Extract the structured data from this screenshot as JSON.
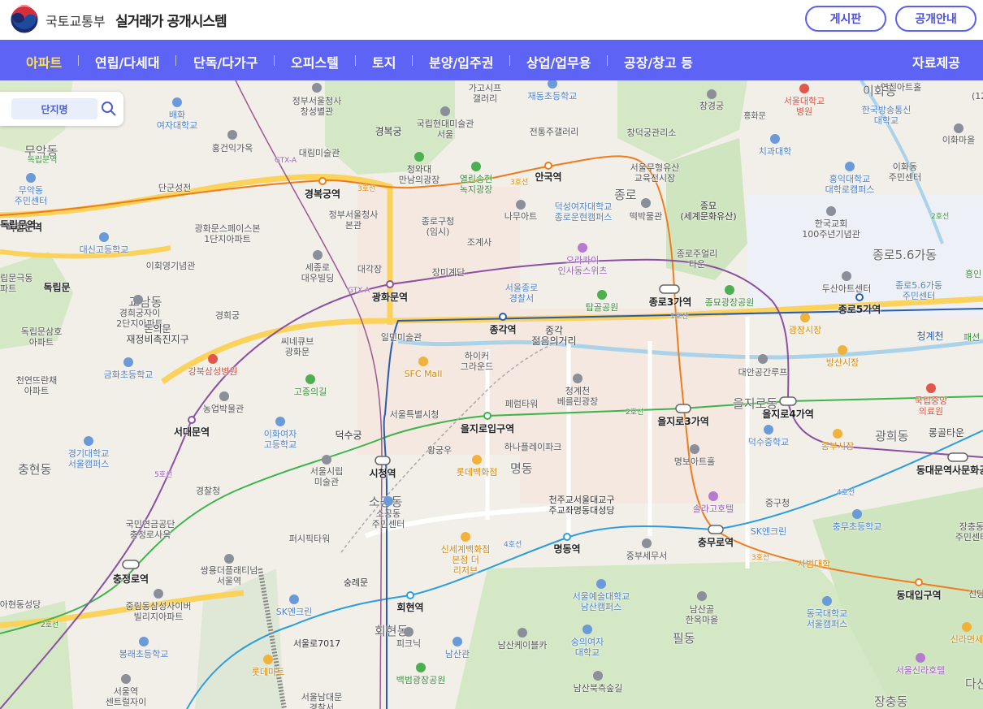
{
  "header": {
    "ministry": "국토교통부",
    "system_title": "실거래가 공개시스템",
    "board_button": "게시판",
    "info_button": "공개안내"
  },
  "nav": {
    "items": [
      "아파트",
      "연립/다세대",
      "단독/다가구",
      "오피스텔",
      "토지",
      "분양/입주권",
      "상업/업무용",
      "공장/창고 등"
    ],
    "active": "아파트",
    "data_button": "자료제공"
  },
  "search": {
    "tab_label": "단지명",
    "icon": "search-icon"
  },
  "colors": {
    "nav_bg": "#5d63f5",
    "active_nav": "#ffe24a",
    "line1": "#2a5caa",
    "line2": "#3cb44a",
    "line3": "#ef7c1c",
    "line4": "#2c9ede",
    "line5": "#8b50a4",
    "road": "#fbd25a"
  },
  "map": {
    "stations": [
      {
        "name": "경복궁역"
      },
      {
        "name": "안국역"
      },
      {
        "name": "광화문역"
      },
      {
        "name": "종각역"
      },
      {
        "name": "종로3가역"
      },
      {
        "name": "종로5가역"
      },
      {
        "name": "을지로입구역"
      },
      {
        "name": "을지로3가역"
      },
      {
        "name": "을지로4가역"
      },
      {
        "name": "시청역"
      },
      {
        "name": "서대문역"
      },
      {
        "name": "충정로역"
      },
      {
        "name": "명동역"
      },
      {
        "name": "충무로역"
      },
      {
        "name": "회현역"
      },
      {
        "name": "동대문역사문화공"
      },
      {
        "name": "동대입구역"
      },
      {
        "name": "독립문역"
      },
      {
        "name": "독립문"
      }
    ],
    "areas": [
      {
        "name": "무악동"
      },
      {
        "name": "종로"
      },
      {
        "name": "종로5.6가동"
      },
      {
        "name": "을지로동"
      },
      {
        "name": "명동"
      },
      {
        "name": "소공동"
      },
      {
        "name": "광희동"
      },
      {
        "name": "필동"
      },
      {
        "name": "회현동"
      },
      {
        "name": "충현동"
      },
      {
        "name": "이화동"
      },
      {
        "name": "장충동"
      },
      {
        "name": "교남동"
      },
      {
        "name": "다산"
      }
    ],
    "pois": [
      {
        "name": "정부서울청사\n창성별관"
      },
      {
        "name": "가고시프\n갤러리"
      },
      {
        "name": "재동초등학교"
      },
      {
        "name": "창경궁"
      },
      {
        "name": "서울대학교\n병원"
      },
      {
        "name": "연진아트홀"
      },
      {
        "name": "한국방송통신\n대학교"
      },
      {
        "name": "이화마을"
      },
      {
        "name": "배화\n여자대학교"
      },
      {
        "name": "경복궁"
      },
      {
        "name": "국립현대미술관\n서울"
      },
      {
        "name": "전통주갤러리"
      },
      {
        "name": "창덕궁관리소"
      },
      {
        "name": "홍화문"
      },
      {
        "name": "치과대학"
      },
      {
        "name": "이화동\n주민센터"
      },
      {
        "name": "홍건익가옥"
      },
      {
        "name": "대림미술관"
      },
      {
        "name": "청와대\n만남의광장"
      },
      {
        "name": "열린송현\n녹지광장"
      },
      {
        "name": "서울무형유산\n교육전시장"
      },
      {
        "name": "홍익대학교\n대학로캠퍼스"
      },
      {
        "name": "독립문역"
      },
      {
        "name": "무악동\n주민센터"
      },
      {
        "name": "단군성전"
      },
      {
        "name": "정부서울청사\n본관"
      },
      {
        "name": "덕성여자대학교\n종로운현캠퍼스"
      },
      {
        "name": "나무아트"
      },
      {
        "name": "떡박물관"
      },
      {
        "name": "종묘\n(세계문화유산)"
      },
      {
        "name": "한국교회\n100주년기념관"
      },
      {
        "name": "종로구청\n(임시)"
      },
      {
        "name": "조계사"
      },
      {
        "name": "광화문스페이스본\n1단지아파트"
      },
      {
        "name": "대신고등학교"
      },
      {
        "name": "이회영기념관"
      },
      {
        "name": "세종로\n대우빌딩"
      },
      {
        "name": "대각장"
      },
      {
        "name": "장미계단"
      },
      {
        "name": "오라카이\n인사동스위츠"
      },
      {
        "name": "종로주얼리\n타운"
      },
      {
        "name": "두산아트센터"
      },
      {
        "name": "종로5.6가동\n주민센터"
      },
      {
        "name": "경희궁자이\n2단지아파트"
      },
      {
        "name": "돈의문\n재정비촉진지구"
      },
      {
        "name": "경희궁"
      },
      {
        "name": "서울종로\n경찰서"
      },
      {
        "name": "탑골공원"
      },
      {
        "name": "종묘광장공원"
      },
      {
        "name": "독립문삼호\n아파트"
      },
      {
        "name": "씨네큐브\n광화문"
      },
      {
        "name": "일민미술관"
      },
      {
        "name": "종각\n젊음의거리"
      },
      {
        "name": "광장시장"
      },
      {
        "name": "청계천"
      },
      {
        "name": "방산시장"
      },
      {
        "name": "금화초등학교"
      },
      {
        "name": "강북삼성병원"
      },
      {
        "name": "SFC Mall"
      },
      {
        "name": "하이커\n그라운드"
      },
      {
        "name": "대안공간루프"
      },
      {
        "name": "천연뜨란채\n아파트"
      },
      {
        "name": "고종의길"
      },
      {
        "name": "청계천\n베를린광장"
      },
      {
        "name": "국립중앙\n의료원"
      },
      {
        "name": "농업박물관"
      },
      {
        "name": "페럼타워"
      },
      {
        "name": "서울특별시청"
      },
      {
        "name": "덕수궁"
      },
      {
        "name": "이화여자\n고등학교"
      },
      {
        "name": "하나플레이파크"
      },
      {
        "name": "덕수중학교"
      },
      {
        "name": "종부시장"
      },
      {
        "name": "롱골타운"
      },
      {
        "name": "경기대학교\n서울캠퍼스"
      },
      {
        "name": "황궁우"
      },
      {
        "name": "명보아트홀"
      },
      {
        "name": "서울시립\n미술관"
      },
      {
        "name": "롯데백화점"
      },
      {
        "name": "중구청"
      },
      {
        "name": "경찰청"
      },
      {
        "name": "천주교서울대교구\n주교좌명동대성당"
      },
      {
        "name": "솔라고호텔"
      },
      {
        "name": "국민연금공단\n충정로사옥"
      },
      {
        "name": "소공동\n주민센터"
      },
      {
        "name": "SK엔크린"
      },
      {
        "name": "충무초등학교"
      },
      {
        "name": "장충동\n주민센터"
      },
      {
        "name": "퍼시픽타워"
      },
      {
        "name": "신세계백화점\n본점 더\n리저브"
      },
      {
        "name": "중부세무서"
      },
      {
        "name": "사범대학"
      },
      {
        "name": "쌍용더플래티넘\n서울역"
      },
      {
        "name": "숭례문"
      },
      {
        "name": "서울예술대학교\n남산캠퍼스"
      },
      {
        "name": "아현동성당"
      },
      {
        "name": "중림동삼성사이버\n빌리지아파트"
      },
      {
        "name": "SK엔크린"
      },
      {
        "name": "동국대학교\n서울캠퍼스"
      },
      {
        "name": "신라면세"
      },
      {
        "name": "남산골\n한옥마을"
      },
      {
        "name": "봉래초등학교"
      },
      {
        "name": "서울로7017"
      },
      {
        "name": "피크닉"
      },
      {
        "name": "숭의여자\n대학교"
      },
      {
        "name": "남산관"
      },
      {
        "name": "남산케이블카"
      },
      {
        "name": "서울신라호텔"
      },
      {
        "name": "롯데마트"
      },
      {
        "name": "서울역\n센트럴자이"
      },
      {
        "name": "백범광장공원"
      },
      {
        "name": "서울남대문\n경찰서"
      },
      {
        "name": "남산북측숲길"
      },
      {
        "name": "흥인"
      },
      {
        "name": "패션"
      },
      {
        "name": "신당"
      },
      {
        "name": "독립문역"
      },
      {
        "name": "립문극동\n파트"
      },
      {
        "name": "(12"
      }
    ],
    "line_labels": [
      "3호선",
      "3호선",
      "2호선",
      "2호선",
      "4호선",
      "4호선",
      "3호선",
      "5호선",
      "2호선",
      "GTX-A",
      "GTX-A",
      "1호선"
    ]
  }
}
